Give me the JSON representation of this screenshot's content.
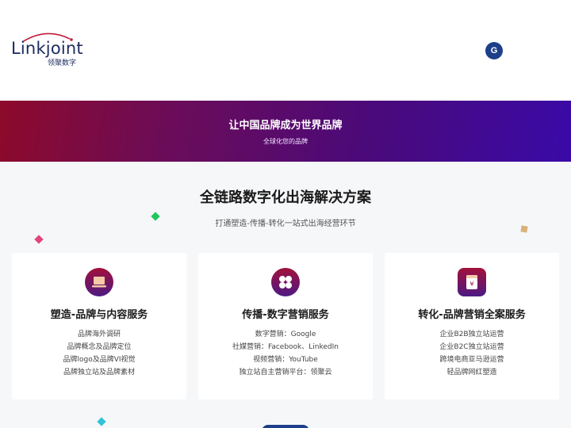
{
  "header": {
    "logo_wordmark": "Linkjoint",
    "logo_subtitle": "领聚数字",
    "google_button_label": "G"
  },
  "banner": {
    "title": "让中国品牌成为世界品牌",
    "subtitle": "全球化您的品牌"
  },
  "section": {
    "title": "全链路数字化出海解决方案",
    "subtitle": "打通塑造-传播-转化一站式出海经营环节"
  },
  "cards": [
    {
      "icon": "laptop-icon",
      "title": "塑造-品牌与内容服务",
      "items": [
        "品牌海外调研",
        "品牌概念及品牌定位",
        "品牌logo及品牌VI视觉",
        "品牌独立站及品牌素材"
      ]
    },
    {
      "icon": "grid-flower-icon",
      "title": "传播-数字营销服务",
      "items": [
        "数字营销：Google",
        "社媒营销：Facebook、LinkedIn",
        "视频营销：YouTube",
        "独立站自主营销平台：领聚云"
      ]
    },
    {
      "icon": "yuan-card-icon",
      "title": "转化-品牌营销全案服务",
      "items": [
        "企业B2B独立站运营",
        "企业B2C独立站运营",
        "跨境电商亚马逊运营",
        "轻品牌网红塑造"
      ]
    }
  ],
  "colors": {
    "brand_navy": "#1b2b5e",
    "banner_start": "#8d0a2a",
    "banner_end": "#3a0aa8",
    "icon_gradient_top": "#a2103a",
    "icon_gradient_bottom": "#4c1a83"
  }
}
